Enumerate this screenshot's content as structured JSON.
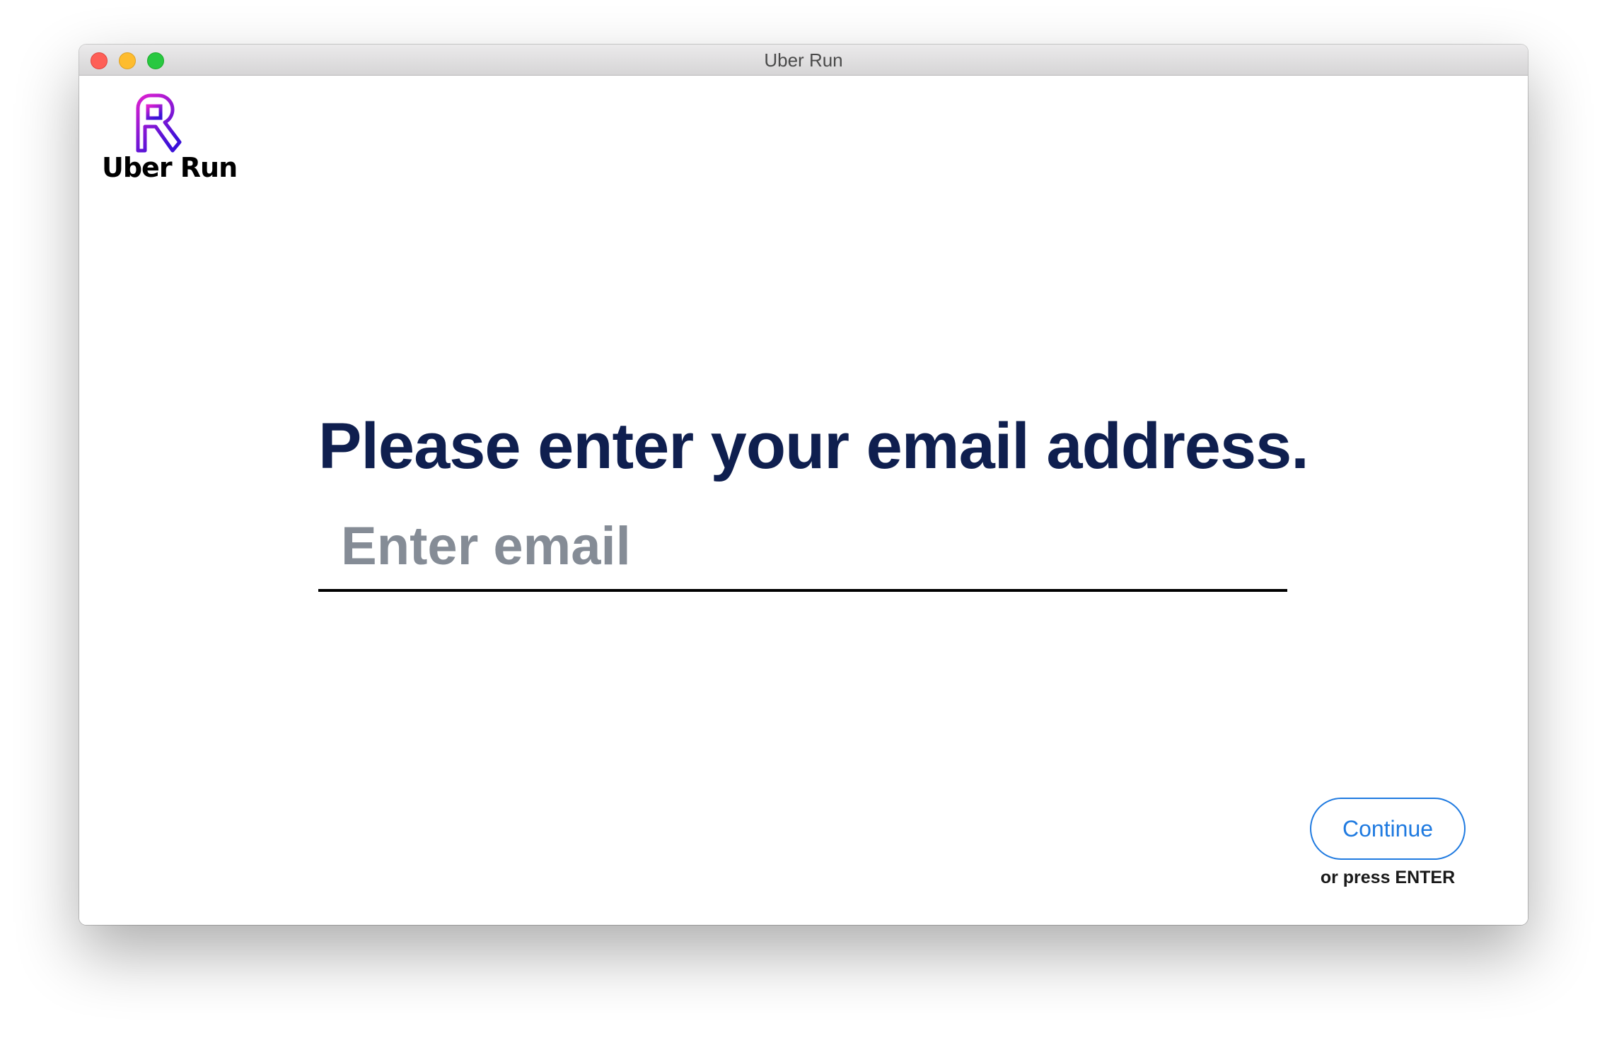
{
  "window": {
    "title": "Uber Run"
  },
  "logo": {
    "text": "Uber Run",
    "icon": "uber-run-r-icon",
    "gradient_start": "#e020d0",
    "gradient_end": "#3a10d8"
  },
  "form": {
    "heading": "Please enter your email address.",
    "email_placeholder": "Enter email",
    "email_value": ""
  },
  "actions": {
    "continue_label": "Continue",
    "enter_hint": "or press ENTER"
  },
  "colors": {
    "heading": "#0f1f4f",
    "accent": "#1f7ae0",
    "placeholder": "#858c96"
  }
}
